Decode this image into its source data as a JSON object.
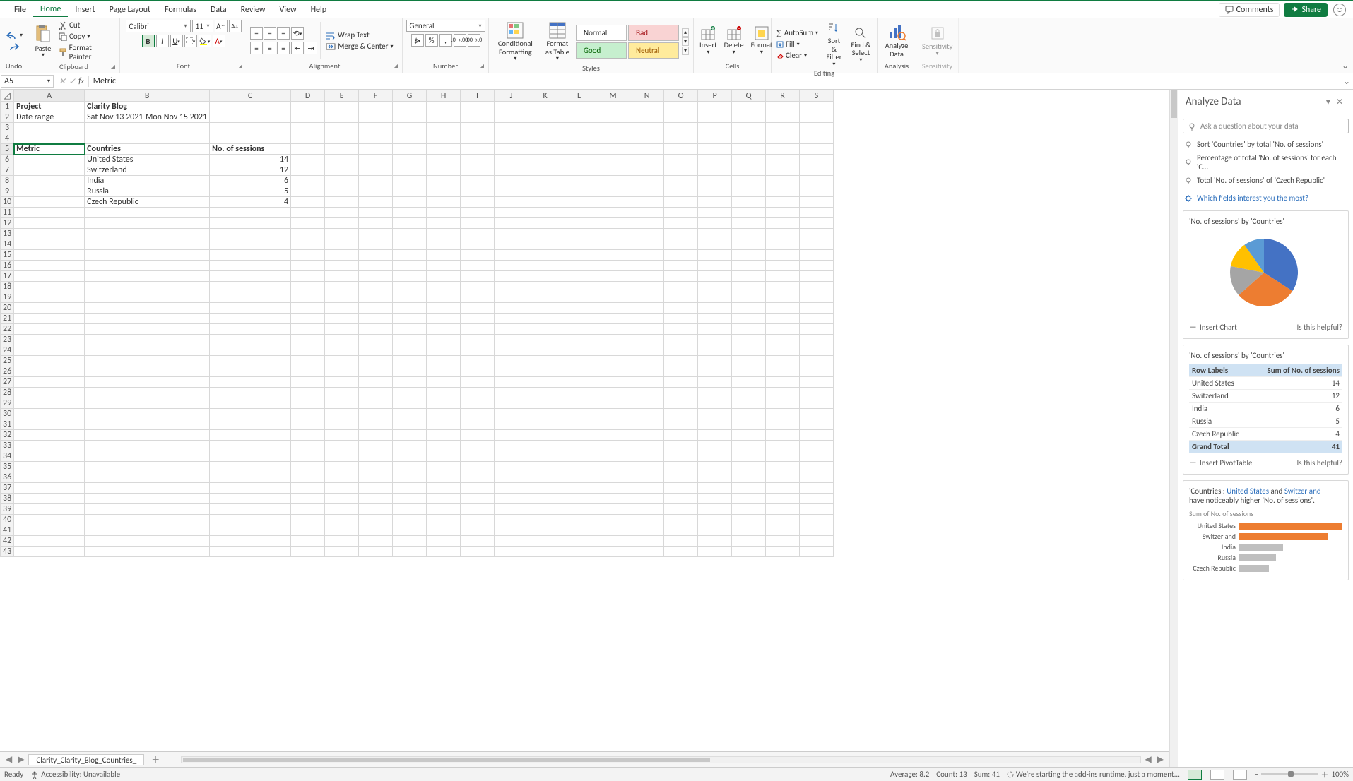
{
  "menu": {
    "file": "File",
    "home": "Home",
    "insert": "Insert",
    "pagelayout": "Page Layout",
    "formulas": "Formulas",
    "data": "Data",
    "review": "Review",
    "view": "View",
    "help": "Help"
  },
  "topright": {
    "comments": "Comments",
    "share": "Share"
  },
  "ribbon": {
    "undo": {
      "label": "Undo"
    },
    "clipboard": {
      "paste": "Paste",
      "cut": "Cut",
      "copy": "Copy",
      "painter": "Format Painter",
      "label": "Clipboard"
    },
    "font": {
      "name": "Calibri",
      "size": "11",
      "label": "Font"
    },
    "alignment": {
      "wrap": "Wrap Text",
      "merge": "Merge & Center",
      "label": "Alignment"
    },
    "number": {
      "format": "General",
      "label": "Number"
    },
    "styles": {
      "cond": "Conditional Formatting",
      "formatas": "Format as Table",
      "normal": "Normal",
      "bad": "Bad",
      "good": "Good",
      "neutral": "Neutral",
      "label": "Styles"
    },
    "cells": {
      "insert": "Insert",
      "delete": "Delete",
      "format": "Format",
      "label": "Cells"
    },
    "editing": {
      "autosum": "AutoSum",
      "fill": "Fill",
      "clear": "Clear",
      "sort": "Sort & Filter",
      "find": "Find & Select",
      "label": "Editing"
    },
    "analysis": {
      "analyze": "Analyze Data",
      "label": "Analysis"
    },
    "sensitivity": {
      "btn": "Sensitivity",
      "label": "Sensitivity"
    }
  },
  "namebox": "A5",
  "formula": "Metric",
  "cells": {
    "A1": "Project",
    "B1": "Clarity Blog",
    "A2": "Date range",
    "B2": "Sat Nov 13 2021-Mon Nov 15 2021",
    "A5": "Metric",
    "B5": "Countries",
    "C5": "No. of sessions",
    "B6": "United States",
    "C6": "14",
    "B7": "Switzerland",
    "C7": "12",
    "B8": "India",
    "C8": "6",
    "B9": "Russia",
    "C9": "5",
    "B10": "Czech Republic",
    "C10": "4"
  },
  "cols": [
    "A",
    "B",
    "C",
    "D",
    "E",
    "F",
    "G",
    "H",
    "I",
    "J",
    "K",
    "L",
    "M",
    "N",
    "O",
    "P",
    "Q",
    "R",
    "S"
  ],
  "rows": 43,
  "pane": {
    "title": "Analyze Data",
    "placeholder": "Ask a question about your data",
    "sug1": "Sort 'Countries' by total 'No. of sessions'",
    "sug2": "Percentage of total 'No. of sessions' for each 'C...",
    "sug3": "Total 'No. of sessions' of 'Czech Republic'",
    "fields": "Which fields interest you the most?",
    "card1_title": "'No. of sessions' by 'Countries'",
    "insert_chart": "Insert Chart",
    "helpful": "Is this helpful?",
    "card2_title": "'No. of sessions' by 'Countries'",
    "row_labels": "Row Labels",
    "sum_header": "Sum of No. of sessions",
    "grand_total": "Grand Total",
    "total_value": "41",
    "insert_pivot": "Insert PivotTable",
    "card3_a": "'Countries': ",
    "card3_us": "United States",
    "card3_and": " and ",
    "card3_sw": "Switzerland",
    "card3_b": "have noticeably higher 'No. of sessions'.",
    "card3_sub": "Sum of No. of sessions"
  },
  "chart_data": {
    "type": "pie",
    "title": "'No. of sessions' by 'Countries'",
    "categories": [
      "United States",
      "Switzerland",
      "India",
      "Russia",
      "Czech Republic"
    ],
    "values": [
      14,
      12,
      6,
      5,
      4
    ],
    "colors": [
      "#4472c4",
      "#ed7d31",
      "#a5a5a5",
      "#ffc000",
      "#5b9bd5"
    ]
  },
  "pivot_rows": [
    {
      "label": "United States",
      "value": "14"
    },
    {
      "label": "Switzerland",
      "value": "12"
    },
    {
      "label": "India",
      "value": "6"
    },
    {
      "label": "Russia",
      "value": "5"
    },
    {
      "label": "Czech Republic",
      "value": "4"
    }
  ],
  "bar_rows": [
    {
      "label": "United States",
      "value": 14,
      "cls": ""
    },
    {
      "label": "Switzerland",
      "value": 12,
      "cls": ""
    },
    {
      "label": "India",
      "value": 6,
      "cls": "grey"
    },
    {
      "label": "Russia",
      "value": 5,
      "cls": "grey"
    },
    {
      "label": "Czech Republic",
      "value": 4,
      "cls": "grey"
    }
  ],
  "sheettab": "Clarity_Clarity_Blog_Countries_",
  "status": {
    "ready": "Ready",
    "access": "Accessibility: Unavailable",
    "avg": "Average: 8.2",
    "count": "Count: 13",
    "sum": "Sum: 41",
    "addins": "We're starting the add-ins runtime, just a moment...",
    "zoom": "100%"
  }
}
